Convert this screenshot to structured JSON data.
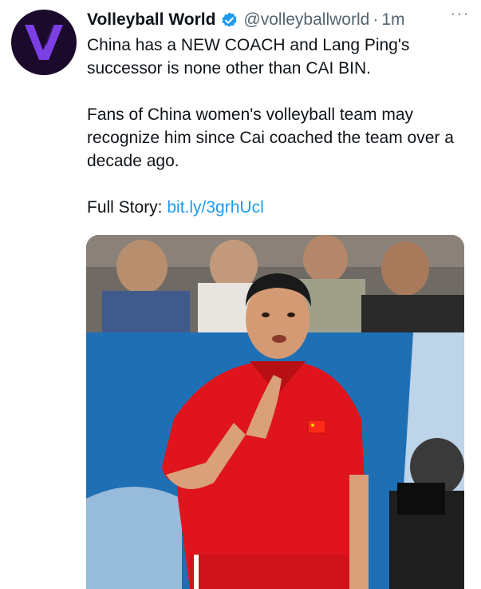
{
  "tweet": {
    "author_name": "Volleyball World",
    "handle": "@volleyballworld",
    "separator": "·",
    "time": "1m",
    "more_label": "···",
    "paragraph_1": "China has a NEW COACH and Lang Ping's successor is none other than CAI BIN.",
    "paragraph_2": "Fans of China women's volleyball team may recognize him since Cai coached the team over a decade ago.",
    "full_story_label": "Full Story: ",
    "full_story_link": "bit.ly/3grhUcl"
  },
  "icons": {
    "avatar": "volleyball-world-logo",
    "verified": "verified-badge-icon",
    "more": "more-options-icon"
  },
  "colors": {
    "link": "#1d9bf0",
    "secondary_text": "#536471",
    "avatar_bg": "#1b0a2b",
    "logo_purple": "#7b3fe4",
    "shirt_red": "#e0141c"
  },
  "media": {
    "alt": "Photo of coach in red shirt"
  }
}
